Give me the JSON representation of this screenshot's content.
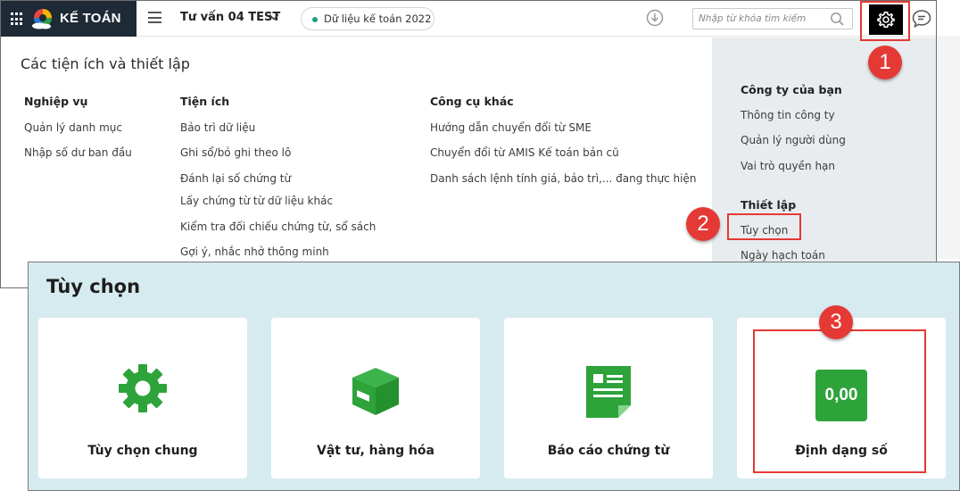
{
  "topbar": {
    "brand": "KẾ TOÁN",
    "company": "Tư vấn 04 TEST",
    "data_year": "Dữ liệu kế toán 2022",
    "search_placeholder": "Nhập từ khóa tìm kiếm"
  },
  "utilities": {
    "title": "Các tiện ích và thiết lập",
    "columns": [
      {
        "heading": "Nghiệp vụ",
        "items": [
          "Quản lý danh mục",
          "Nhập số dư ban đầu"
        ]
      },
      {
        "heading": "Tiện ích",
        "items": [
          "Bảo trì dữ liệu",
          "Ghi sổ/bỏ ghi theo lô",
          "Đánh lại số chứng từ",
          "Lấy chứng từ từ dữ liệu khác",
          "Kiểm tra đối chiếu chứng từ, sổ sách",
          "Gợi ý, nhắc nhở thông minh"
        ]
      },
      {
        "heading": "Công cụ khác",
        "items": [
          "Hướng dẫn chuyển đổi từ SME",
          "Chuyển đổi từ AMIS Kế toán bản cũ",
          "Danh sách lệnh tính giá, bảo trì,... đang thực hiện"
        ]
      }
    ]
  },
  "right_panel": {
    "company_heading": "Công ty của bạn",
    "company_items": [
      "Thông tin công ty",
      "Quản lý người dùng",
      "Vai trò quyền hạn"
    ],
    "settings_heading": "Thiết lập",
    "settings_items": [
      "Tùy chọn",
      "Ngày hạch toán"
    ]
  },
  "markers": [
    "1",
    "2",
    "3"
  ],
  "options": {
    "title": "Tùy chọn",
    "cards": [
      {
        "label": "Tùy chọn chung",
        "icon": "gear-icon"
      },
      {
        "label": "Vật tư, hàng hóa",
        "icon": "package-icon"
      },
      {
        "label": "Báo cáo chứng từ",
        "icon": "document-icon"
      },
      {
        "label": "Định dạng số",
        "icon": "number-format-icon",
        "badge": "0,00"
      }
    ]
  },
  "colors": {
    "accent_red": "#e53935",
    "brand_dark": "#1e2a36",
    "icon_green": "#2da33a",
    "panel_bg": "#d6ebef"
  }
}
